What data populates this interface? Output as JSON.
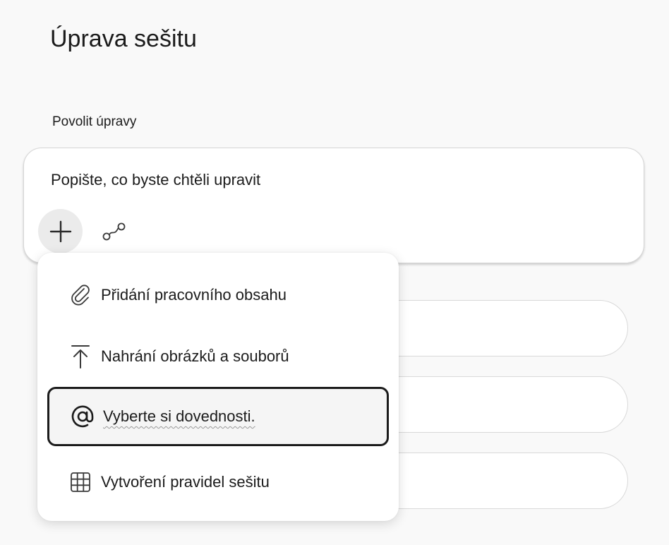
{
  "page": {
    "title": "Úprava sešitu",
    "section_label": "Povolit úpravy"
  },
  "prompt": {
    "placeholder": "Popište, co byste chtěli upravit"
  },
  "menu": {
    "items": [
      {
        "label": "Přidání pracovního obsahu",
        "icon": "paperclip-icon"
      },
      {
        "label": "Nahrání obrázků a souborů",
        "icon": "upload-icon"
      },
      {
        "label": "Vyberte si dovednosti.",
        "icon": "at-sign-icon"
      },
      {
        "label": "Vytvoření pravidel sešitu",
        "icon": "table-grid-icon"
      }
    ]
  },
  "colors": {
    "background": "#f9f9f9",
    "surface": "#ffffff",
    "text": "#1b1b1b",
    "plus_button_bg": "#ebebeb",
    "focus_ring": "#1b1b1b"
  }
}
